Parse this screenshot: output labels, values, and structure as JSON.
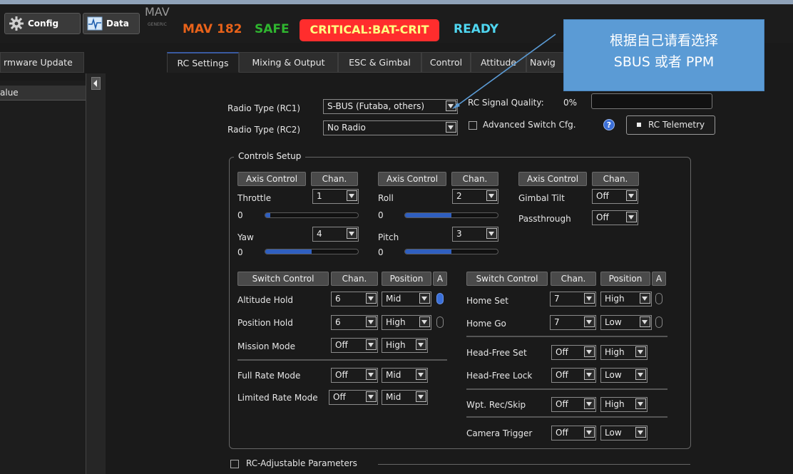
{
  "topbar": {
    "config_label": "Config",
    "data_label": "Data",
    "logo_text": "MAV",
    "logo_sub": "GENERIC",
    "mav_id": "MAV 182",
    "safe": "SAFE",
    "critical": "CRITICAL:BAT-CRIT",
    "ready": "READY",
    "colors": {
      "mav": "#e8621a",
      "safe": "#2fb52f",
      "critical_bg": "#ff2d2d",
      "critical_text": "#ffff80",
      "ready": "#4fd6f0"
    }
  },
  "tabs": {
    "firmware": "rmware Update",
    "items": [
      "RC Settings",
      "Mixing & Output",
      "ESC & Gimbal",
      "Control",
      "Attitude",
      "Navig"
    ],
    "active": "RC Settings"
  },
  "left": {
    "header": "alue"
  },
  "radio": {
    "rc1_label": "Radio Type (RC1)",
    "rc1_value": "S-BUS (Futaba, others)",
    "rc2_label": "Radio Type (RC2)",
    "rc2_value": "No Radio",
    "signal_label": "RC Signal Quality:",
    "signal_value": "0%",
    "advanced_label": "Advanced Switch Cfg.",
    "help": "?",
    "telemetry_label": "RC Telemetry"
  },
  "controls": {
    "title": "Controls Setup",
    "axis_header": "Axis Control",
    "chan_header": "Chan.",
    "throttle": {
      "label": "Throttle",
      "chan": "1",
      "value": "0",
      "level": 0.05
    },
    "yaw": {
      "label": "Yaw",
      "chan": "4",
      "value": "0",
      "level": 0.5
    },
    "roll": {
      "label": "Roll",
      "chan": "2",
      "value": "0",
      "level": 0.5
    },
    "pitch": {
      "label": "Pitch",
      "chan": "3",
      "value": "0",
      "level": 0.5
    },
    "gimbal_tilt": {
      "label": "Gimbal Tilt",
      "chan": "Off"
    },
    "passthrough": {
      "label": "Passthrough",
      "chan": "Off"
    }
  },
  "switches": {
    "header": "Switch Control",
    "chan_header": "Chan.",
    "pos_header": "Position",
    "a_header": "A",
    "left": [
      {
        "label": "Altitude Hold",
        "chan": "6",
        "pos": "Mid",
        "led": true
      },
      {
        "label": "Position Hold",
        "chan": "6",
        "pos": "High",
        "led": false
      },
      {
        "label": "Mission Mode",
        "chan": "Off",
        "pos": "High"
      },
      {
        "label": "Full Rate Mode",
        "chan": "Off",
        "pos": "Mid"
      },
      {
        "label": "Limited Rate Mode",
        "chan": "Off",
        "pos": "Mid"
      }
    ],
    "right": [
      {
        "label": "Home Set",
        "chan": "7",
        "pos": "High",
        "led": false
      },
      {
        "label": "Home Go",
        "chan": "7",
        "pos": "Low",
        "led": false
      },
      {
        "label": "Head-Free Set",
        "chan": "Off",
        "pos": "High"
      },
      {
        "label": "Head-Free Lock",
        "chan": "Off",
        "pos": "Low"
      },
      {
        "label": "Wpt. Rec/Skip",
        "chan": "Off",
        "pos": "High"
      },
      {
        "label": "Camera Trigger",
        "chan": "Off",
        "pos": "Low"
      }
    ]
  },
  "rc_adjustable": "RC-Adjustable Parameters",
  "callout": {
    "line1": "根据自己请看选择",
    "line2": "SBUS 或者 PPM"
  }
}
